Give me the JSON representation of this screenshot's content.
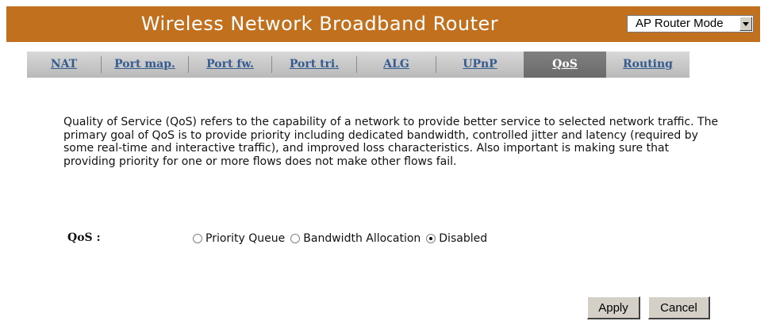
{
  "header": {
    "title": "Wireless Network Broadband Router",
    "background_color": "#c1701d",
    "mode_select": {
      "selected": "AP Router Mode"
    }
  },
  "tabs": [
    {
      "label": "NAT",
      "active": false
    },
    {
      "label": "Port map.",
      "active": false
    },
    {
      "label": "Port fw.",
      "active": false
    },
    {
      "label": "Port tri.",
      "active": false
    },
    {
      "label": "ALG",
      "active": false
    },
    {
      "label": "UPnP",
      "active": false
    },
    {
      "label": "QoS",
      "active": true
    },
    {
      "label": "Routing",
      "active": false
    }
  ],
  "description": "Quality of Service (QoS) refers to the capability of a network to provide better service to selected network traffic. The primary goal of QoS is to provide priority including dedicated bandwidth, controlled jitter and latency (required by some real-time and interactive traffic), and improved loss characteristics. Also important is making sure that providing priority for one or more flows does not make other flows fail.",
  "qos": {
    "label": "QoS :",
    "options": [
      {
        "label": "Priority Queue",
        "checked": false
      },
      {
        "label": "Bandwidth Allocation",
        "checked": false
      },
      {
        "label": "Disabled",
        "checked": true
      }
    ]
  },
  "buttons": {
    "apply": "Apply",
    "cancel": "Cancel"
  }
}
